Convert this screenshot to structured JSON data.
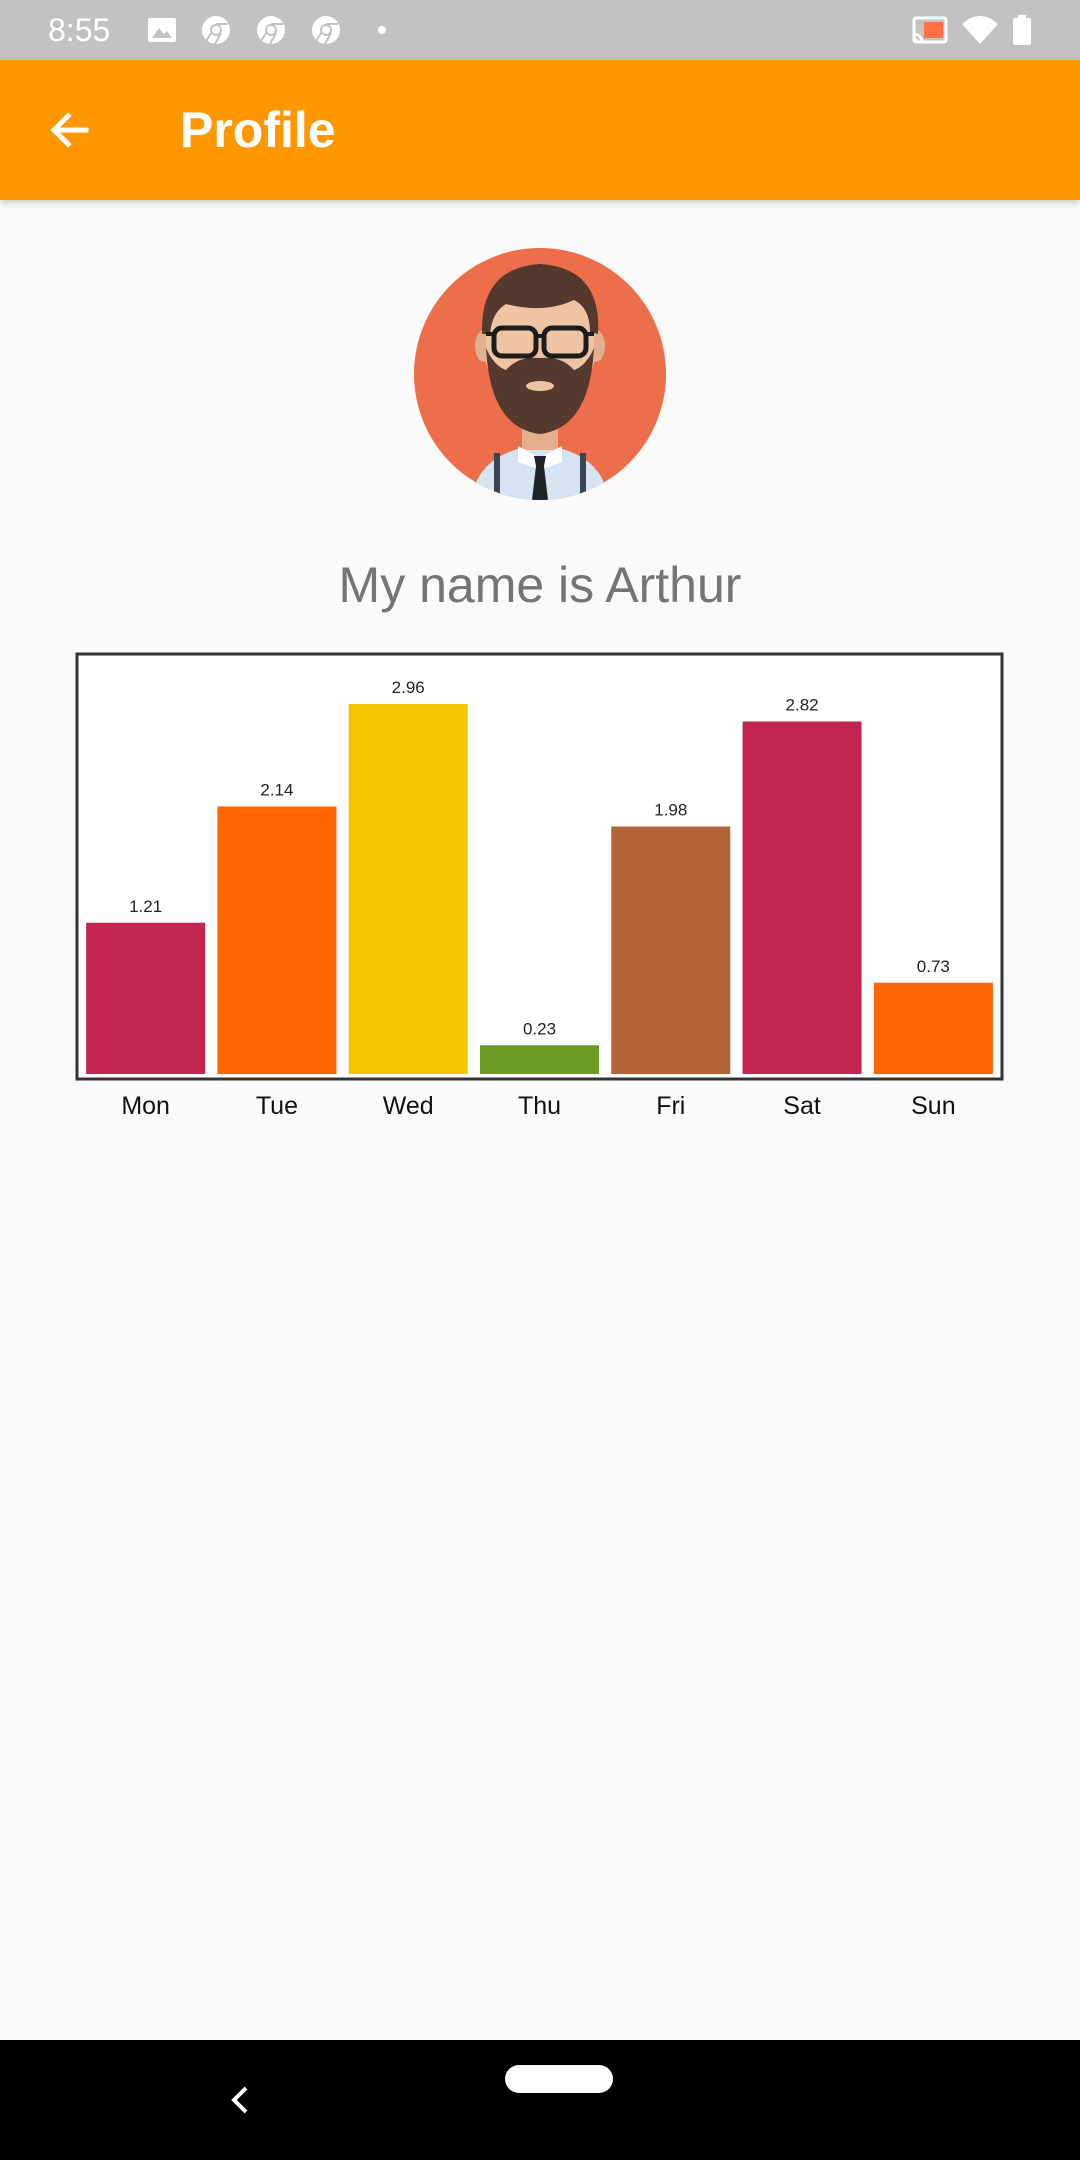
{
  "status_bar": {
    "time": "8:55",
    "left_icons": [
      "image-icon",
      "chrome-icon",
      "chrome-icon",
      "chrome-icon",
      "dot-icon"
    ],
    "right_icons": [
      "cast-icon",
      "wifi-icon",
      "battery-icon"
    ],
    "cast_accent": "#ff7043"
  },
  "app_bar": {
    "title": "Profile",
    "back_icon": "arrow-back-icon",
    "color": "#ff9800"
  },
  "profile": {
    "avatar_icon": "bearded-man-avatar-icon",
    "avatar_bg": "#ed6e4b",
    "name_text": "My name is Arthur"
  },
  "chart_data": {
    "type": "bar",
    "categories": [
      "Mon",
      "Tue",
      "Wed",
      "Thu",
      "Fri",
      "Sat",
      "Sun"
    ],
    "values": [
      1.21,
      2.14,
      2.96,
      0.23,
      1.98,
      2.82,
      0.73
    ],
    "value_labels": [
      "1.21",
      "2.14",
      "2.96",
      "0.23",
      "1.98",
      "2.82",
      "0.73"
    ],
    "colors": [
      "#c2254f",
      "#ff6500",
      "#f5c600",
      "#6b9b24",
      "#b36537",
      "#c2254f",
      "#ff6500"
    ],
    "ylim": [
      0,
      3.2
    ],
    "grid": false,
    "legend": "none",
    "title": "",
    "xlabel": "",
    "ylabel": ""
  },
  "nav_bar": {
    "back_icon": "nav-back-icon",
    "home_icon": "nav-home-pill-icon"
  }
}
